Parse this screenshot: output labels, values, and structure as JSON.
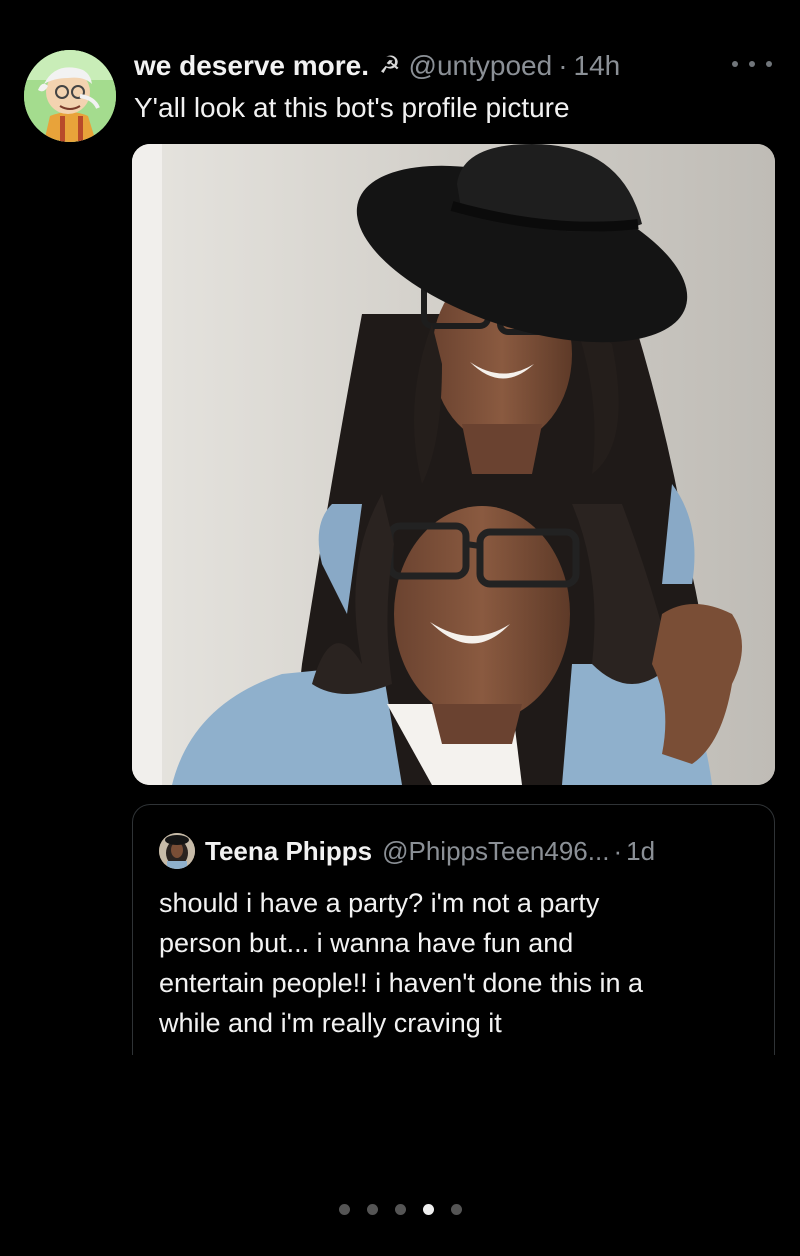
{
  "tweet": {
    "display_name": "we deserve more.",
    "handle": "@untypoed",
    "separator": "·",
    "time": "14h",
    "text": "Y'all look at this bot's profile picture",
    "avatar_icon": "cartoon-character-avatar",
    "name_emoji": "☭"
  },
  "media": {
    "description_icon": "profile-photo-image"
  },
  "quoted_tweet": {
    "display_name": "Teena Phipps",
    "handle": "@PhippsTeen496...",
    "separator": "·",
    "time": "1d",
    "lines": [
      "should i have a party? i'm not a party",
      "person but... i wanna have fun and",
      "entertain people!! i haven't done this in a",
      "while and i'm really craving it"
    ]
  },
  "carousel": {
    "total": 5,
    "active_index": 3
  },
  "colors": {
    "background": "#000000",
    "text": "#f2f2f2",
    "muted": "#8b9096",
    "border": "#2f3336"
  }
}
